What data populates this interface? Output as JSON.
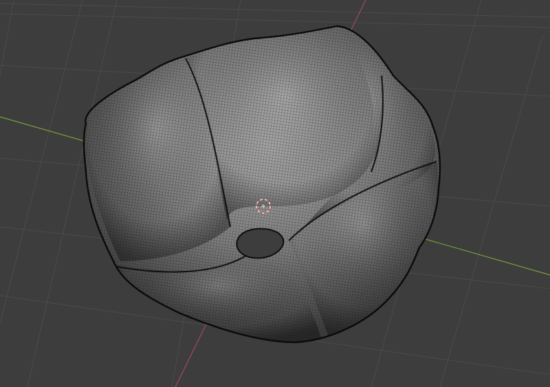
{
  "viewport": {
    "background_color": "#3d3d3d",
    "grid_color": "#4b4b4b",
    "x_axis_color": "#a34b5a",
    "y_axis_color": "#7aa13a"
  },
  "object": {
    "shape": "wrinkled-torus-mesh",
    "display_mode": "wireframe-over-solid",
    "surface_color": "#8c8c8c",
    "wire_color": "#111111"
  },
  "cursor_3d": {
    "icon": "3d-cursor-icon",
    "ring_color": "#e0e0e0",
    "accent_color": "#d9534f"
  }
}
